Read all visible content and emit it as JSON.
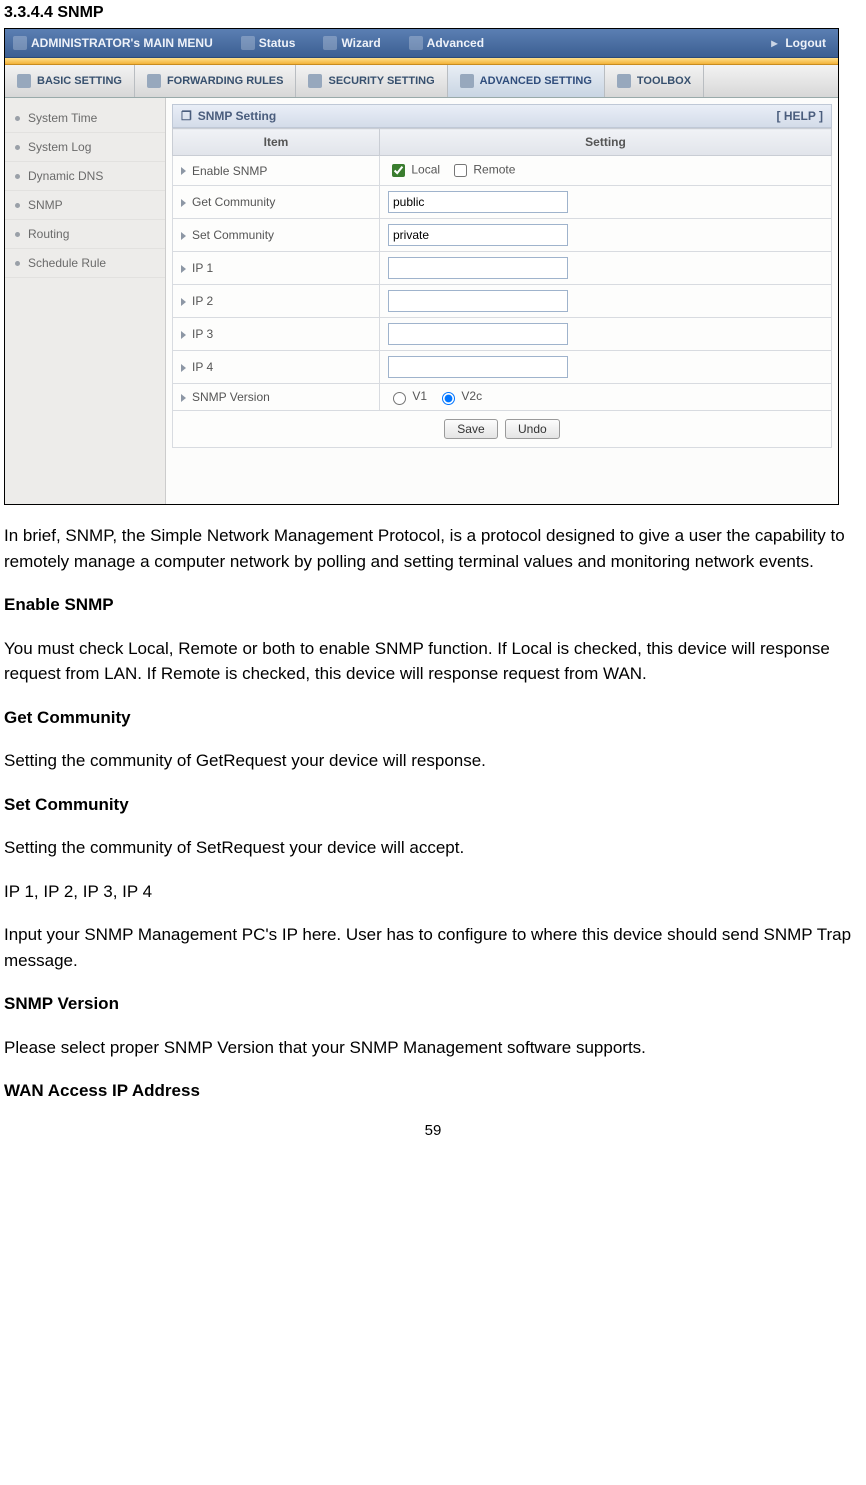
{
  "heading": "3.3.4.4 SNMP",
  "app": {
    "topbar": {
      "main_menu": "ADMINISTRATOR's MAIN MENU",
      "status": "Status",
      "wizard": "Wizard",
      "advanced": "Advanced",
      "logout": "Logout"
    },
    "tabs": {
      "basic": "BASIC SETTING",
      "forwarding": "FORWARDING RULES",
      "security": "SECURITY SETTING",
      "advanced": "ADVANCED SETTING",
      "toolbox": "TOOLBOX"
    },
    "sidebar": [
      "System Time",
      "System Log",
      "Dynamic DNS",
      "SNMP",
      "Routing",
      "Schedule Rule"
    ],
    "panel": {
      "title": "SNMP Setting",
      "help": "[ HELP ]",
      "col_item": "Item",
      "col_setting": "Setting",
      "rows": {
        "enable": "Enable SNMP",
        "enable_local": "Local",
        "enable_remote": "Remote",
        "get": "Get Community",
        "get_val": "public",
        "set": "Set Community",
        "set_val": "private",
        "ip1": "IP 1",
        "ip2": "IP 2",
        "ip3": "IP 3",
        "ip4": "IP 4",
        "ver": "SNMP Version",
        "v1": "V1",
        "v2c": "V2c"
      },
      "buttons": {
        "save": "Save",
        "undo": "Undo"
      }
    }
  },
  "body": {
    "p1": "In brief, SNMP, the Simple Network Management Protocol, is a protocol designed to give a user the capability to remotely manage a computer network by polling and setting terminal values and monitoring network events.",
    "h_enable": "Enable SNMP",
    "p2": "You must check Local, Remote or both to enable SNMP function. If Local is checked, this device will response request from LAN. If Remote is checked, this device will response request from WAN.",
    "h_get": "Get Community",
    "p3": "Setting the community of GetRequest your device will response.",
    "h_set": "Set Community",
    "p4": "Setting the community of SetRequest your device will accept.",
    "p5": "IP 1, IP 2, IP 3, IP 4",
    "p6": "Input your SNMP Management PC's IP here. User has to configure to where this device should send SNMP Trap message.",
    "h_ver": "SNMP Version",
    "p7": "Please select proper SNMP Version that your SNMP Management software supports.",
    "h_wan": "WAN Access IP Address"
  },
  "page_number": "59"
}
